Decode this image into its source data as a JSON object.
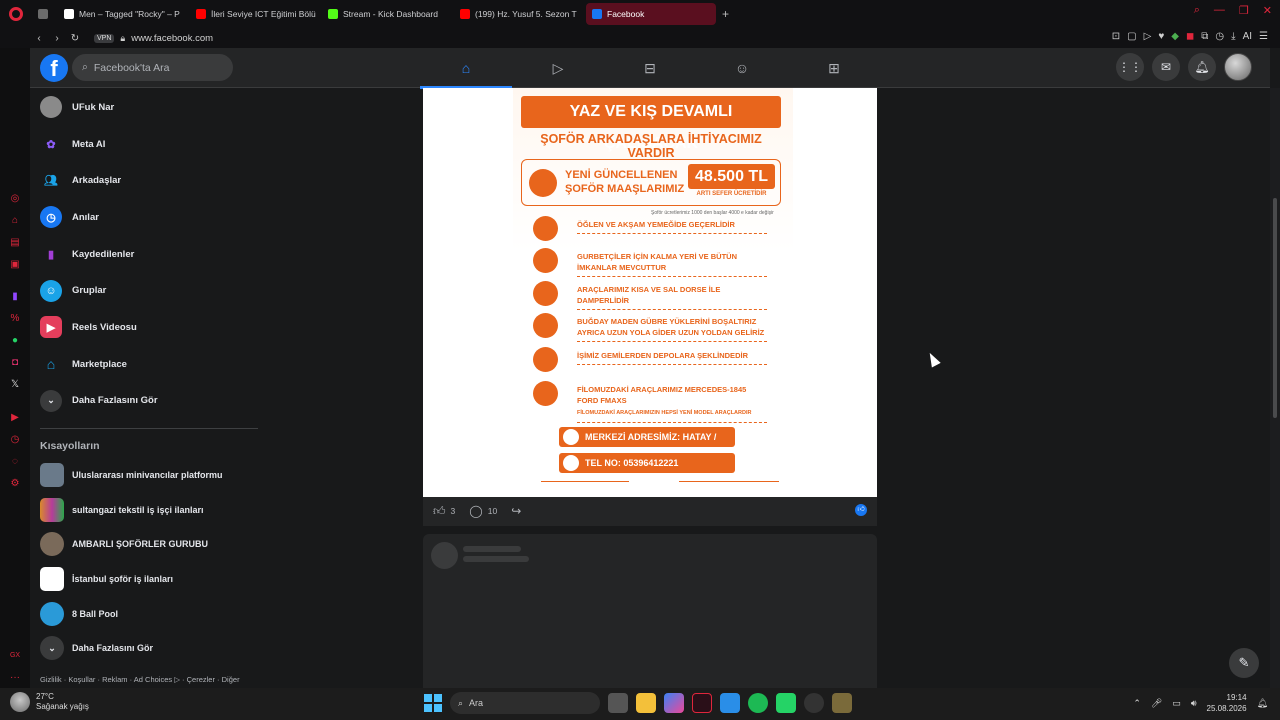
{
  "browser": {
    "tabs": [
      {
        "label": "",
        "icon": "mail-icon",
        "color": "#6b6b6b"
      },
      {
        "label": "Men – Tagged \"Rocky\" – P",
        "icon": "t-site-icon",
        "color": "#ffffff"
      },
      {
        "label": "İleri Seviye ICT Eğitimi Bölü",
        "icon": "youtube-icon",
        "color": "#ff0000"
      },
      {
        "label": "Stream - Kick Dashboard",
        "icon": "kick-icon",
        "color": "#53fc18"
      },
      {
        "label": "(199) Hz. Yusuf 5. Sezon T",
        "icon": "youtube-icon",
        "color": "#ff0000"
      },
      {
        "label": "Facebook",
        "icon": "facebook-icon",
        "color": "#1877f2"
      }
    ],
    "url": "www.facebook.com",
    "vpn_label": "VPN",
    "ext_ai_label": "AI"
  },
  "header": {
    "logo": "f",
    "search_placeholder": "Facebook'ta Ara",
    "nav_tabs": [
      "home-icon",
      "video-icon",
      "marketplace-icon",
      "groups-icon",
      "gaming-icon"
    ]
  },
  "leftnav": {
    "items": [
      {
        "label": "UFuk Nar",
        "icon": "avatar-icon",
        "color": "#8a8a8a"
      },
      {
        "label": "Meta AI",
        "icon": "meta-ai-icon",
        "color": "#8b5cf6"
      },
      {
        "label": "Arkadaşlar",
        "icon": "friends-icon",
        "color": "#1877f2"
      },
      {
        "label": "Anılar",
        "icon": "memories-icon",
        "color": "#1877f2"
      },
      {
        "label": "Kaydedilenler",
        "icon": "saved-icon",
        "color": "#a23ed6"
      },
      {
        "label": "Gruplar",
        "icon": "groups-icon",
        "color": "#1aa3e8"
      },
      {
        "label": "Reels Videosu",
        "icon": "reels-icon",
        "color": "#e43e5c"
      },
      {
        "label": "Marketplace",
        "icon": "marketplace-icon",
        "color": "#1aa3e8"
      },
      {
        "label": "Daha Fazlasını Gör",
        "icon": "chevron-down-icon",
        "color": "#3a3b3c"
      }
    ],
    "shortcuts_title": "Kısayolların",
    "shortcuts": [
      {
        "label": "Uluslararası minivancılar platformu",
        "color": "#6a7a8a"
      },
      {
        "label": "sultangazi tekstil iş işçi ilanları",
        "color": "#d98a2b"
      },
      {
        "label": "AMBARLI ŞOFÖRLER GURUBU",
        "color": "#7a6a5a"
      },
      {
        "label": "İstanbul şoför iş ilanları",
        "color": "#ffffff"
      },
      {
        "label": "8 Ball Pool",
        "color": "#2a9ad8"
      },
      {
        "label": "Daha Fazlasını Gör",
        "color": "#3a3b3c"
      }
    ],
    "footer": "Gizlilik · Koşullar · Reklam · Ad Choices ▷ · Çerezler · Diğer"
  },
  "post": {
    "poster": {
      "headline": "YAZ VE KIŞ DEVAMLI ÇALIŞACAK",
      "subhead": "ŞOFÖR ARKADAŞLARA İHTİYACIMIZ VARDIR",
      "salary_label_1": "YENİ GÜNCELLENEN",
      "salary_label_2": "ŞOFÖR MAAŞLARIMIZ",
      "price": "48.500 TL",
      "price_sub": "ARTI SEFER ÜCRETİDİR",
      "note": "Şoför ücretlerimiz 1000 den başlar 4000 e kadar değişir",
      "features": [
        "ÖĞLEN VE AKŞAM YEMEĞİDE GEÇERLİDİR",
        "GURBETÇİLER İÇİN KALMA YERİ VE BÜTÜN İMKANLAR MEVCUTTUR",
        "ARAÇLARIMIZ KISA VE SAL DORSE İLE DAMPERLİDİR",
        "BUĞDAY MADEN GÜBRE YÜKLERİNİ BOŞALTIRIZ AYRICA UZUN YOLA GİDER UZUN YOLDAN GELİRİZ",
        "İŞİMİZ GEMİLERDEN DEPOLARA ŞEKLİNDEDİR",
        "FİLOMUZDAKİ ARAÇLARIMIZ MERCEDES-1845 FORD FMAXS"
      ],
      "fleet_note": "FİLOMUZDAKİ ARAÇLARIMIZIN HEPSİ YENİ MODEL ARAÇLARDIR",
      "address": "MERKEZİ ADRESİMİZ: HATAY / PAYASTADIR",
      "phone": "TEL NO: 05396412221",
      "accent": "#e8651c"
    },
    "likes": "3",
    "comments": "10"
  },
  "taskbar": {
    "temp": "27°C",
    "weather": "Sağanak yağış",
    "weather_badge": "1",
    "search_placeholder": "Ara",
    "time": "19:14",
    "date": "25.08.2026"
  }
}
